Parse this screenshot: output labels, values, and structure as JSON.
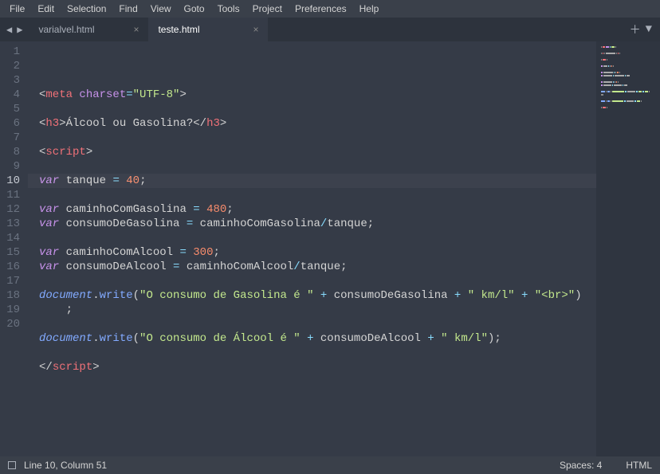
{
  "menubar": [
    "File",
    "Edit",
    "Selection",
    "Find",
    "View",
    "Goto",
    "Tools",
    "Project",
    "Preferences",
    "Help"
  ],
  "tabs": [
    {
      "label": "varialvel.html",
      "active": false
    },
    {
      "label": "teste.html",
      "active": true
    }
  ],
  "status": {
    "cursor": "Line 10, Column 51",
    "spaces": "Spaces: 4",
    "lang": "HTML"
  },
  "code": {
    "lines": [
      [
        {
          "t": "<",
          "c": "punc"
        },
        {
          "t": "meta ",
          "c": "tag"
        },
        {
          "t": "charset",
          "c": "attr"
        },
        {
          "t": "=",
          "c": "op"
        },
        {
          "t": "\"UTF-8\"",
          "c": "str"
        },
        {
          "t": ">",
          "c": "punc"
        }
      ],
      [],
      [
        {
          "t": "<",
          "c": "punc"
        },
        {
          "t": "h3",
          "c": "tag"
        },
        {
          "t": ">",
          "c": "punc"
        },
        {
          "t": "Álcool ou Gasolina?",
          "c": "txt"
        },
        {
          "t": "</",
          "c": "punc"
        },
        {
          "t": "h3",
          "c": "tag"
        },
        {
          "t": ">",
          "c": "punc"
        }
      ],
      [],
      [
        {
          "t": "<",
          "c": "punc"
        },
        {
          "t": "script",
          "c": "tag"
        },
        {
          "t": ">",
          "c": "punc"
        }
      ],
      [],
      [
        {
          "t": "var",
          "c": "kw"
        },
        {
          "t": " tanque ",
          "c": "txt"
        },
        {
          "t": "=",
          "c": "op"
        },
        {
          "t": " ",
          "c": "txt"
        },
        {
          "t": "40",
          "c": "num"
        },
        {
          "t": ";",
          "c": "punc"
        }
      ],
      [],
      [
        {
          "t": "var",
          "c": "kw"
        },
        {
          "t": " caminhoComGasolina ",
          "c": "txt"
        },
        {
          "t": "=",
          "c": "op"
        },
        {
          "t": " ",
          "c": "txt"
        },
        {
          "t": "480",
          "c": "num"
        },
        {
          "t": ";",
          "c": "punc"
        }
      ],
      [
        {
          "t": "var",
          "c": "kw"
        },
        {
          "t": " consumoDeGasolina ",
          "c": "txt"
        },
        {
          "t": "=",
          "c": "op"
        },
        {
          "t": " caminhoComGasolina",
          "c": "txt"
        },
        {
          "t": "/",
          "c": "op"
        },
        {
          "t": "tanque;",
          "c": "txt"
        }
      ],
      [],
      [
        {
          "t": "var",
          "c": "kw"
        },
        {
          "t": " caminhoComAlcool ",
          "c": "txt"
        },
        {
          "t": "=",
          "c": "op"
        },
        {
          "t": " ",
          "c": "txt"
        },
        {
          "t": "300",
          "c": "num"
        },
        {
          "t": ";",
          "c": "punc"
        }
      ],
      [
        {
          "t": "var",
          "c": "kw"
        },
        {
          "t": " consumoDeAlcool ",
          "c": "txt"
        },
        {
          "t": "=",
          "c": "op"
        },
        {
          "t": " caminhoComAlcool",
          "c": "txt"
        },
        {
          "t": "/",
          "c": "op"
        },
        {
          "t": "tanque;",
          "c": "txt"
        }
      ],
      [],
      [
        {
          "t": "document",
          "c": "var"
        },
        {
          "t": ".",
          "c": "punc"
        },
        {
          "t": "write",
          "c": "fn"
        },
        {
          "t": "(",
          "c": "punc"
        },
        {
          "t": "\"O consumo de Gasolina é \"",
          "c": "str"
        },
        {
          "t": " + ",
          "c": "op"
        },
        {
          "t": "consumoDeGasolina",
          "c": "txt"
        },
        {
          "t": " + ",
          "c": "op"
        },
        {
          "t": "\" km/l\"",
          "c": "str"
        },
        {
          "t": " + ",
          "c": "op"
        },
        {
          "t": "\"<br>\"",
          "c": "str"
        },
        {
          "t": ")",
          "c": "punc"
        }
      ],
      [
        {
          "t": "    ;",
          "c": "punc"
        }
      ],
      [],
      [
        {
          "t": "document",
          "c": "var"
        },
        {
          "t": ".",
          "c": "punc"
        },
        {
          "t": "write",
          "c": "fn"
        },
        {
          "t": "(",
          "c": "punc"
        },
        {
          "t": "\"O consumo de Álcool é \"",
          "c": "str"
        },
        {
          "t": " + ",
          "c": "op"
        },
        {
          "t": "consumoDeAlcool",
          "c": "txt"
        },
        {
          "t": " + ",
          "c": "op"
        },
        {
          "t": "\" km/l\"",
          "c": "str"
        },
        {
          "t": ");",
          "c": "punc"
        }
      ],
      [],
      [
        {
          "t": "</",
          "c": "punc"
        },
        {
          "t": "script",
          "c": "tag"
        },
        {
          "t": ">",
          "c": "punc"
        }
      ]
    ],
    "currentLine": 10
  }
}
